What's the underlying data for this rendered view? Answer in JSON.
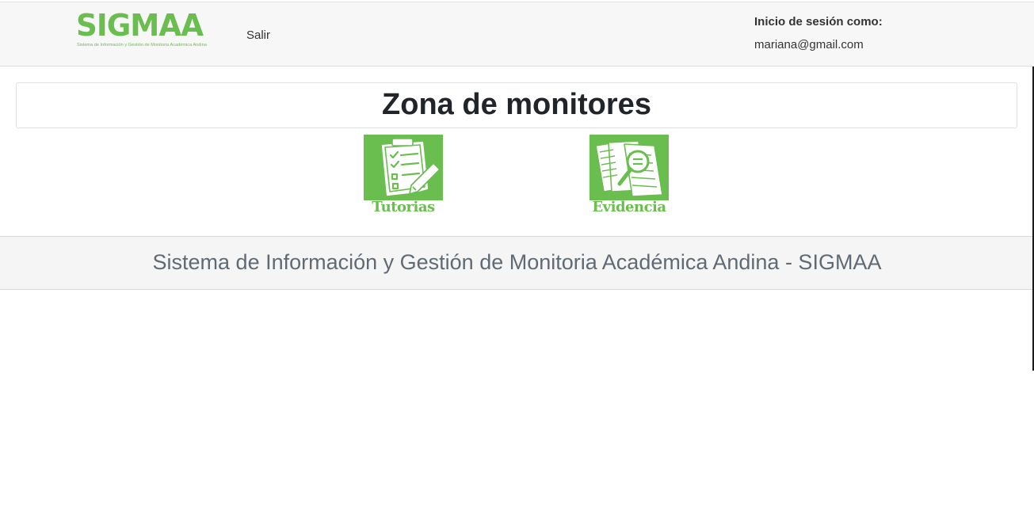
{
  "header": {
    "logo": {
      "title": "SIGMAA",
      "subtitle": "Sistema de Información y Gestión de Monitoria Académica Andina",
      "color": "#6abe4f"
    },
    "nav_link": "Salir",
    "session_label": "Inicio de sesión como:",
    "session_user": "mariana@gmail.com"
  },
  "main": {
    "title": "Zona de monitores",
    "tiles": [
      {
        "label": "Tutorias",
        "icon": "checklist-clipboard-icon"
      },
      {
        "label": "Evidencia",
        "icon": "document-magnifier-icon"
      }
    ]
  },
  "footer": {
    "text": "Sistema de Información y Gestión de Monitoria Académica Andina - SIGMAA"
  },
  "colors": {
    "brand": "#6abe4f",
    "navbar_bg": "#f7f7f7",
    "footer_text": "#606a74"
  }
}
